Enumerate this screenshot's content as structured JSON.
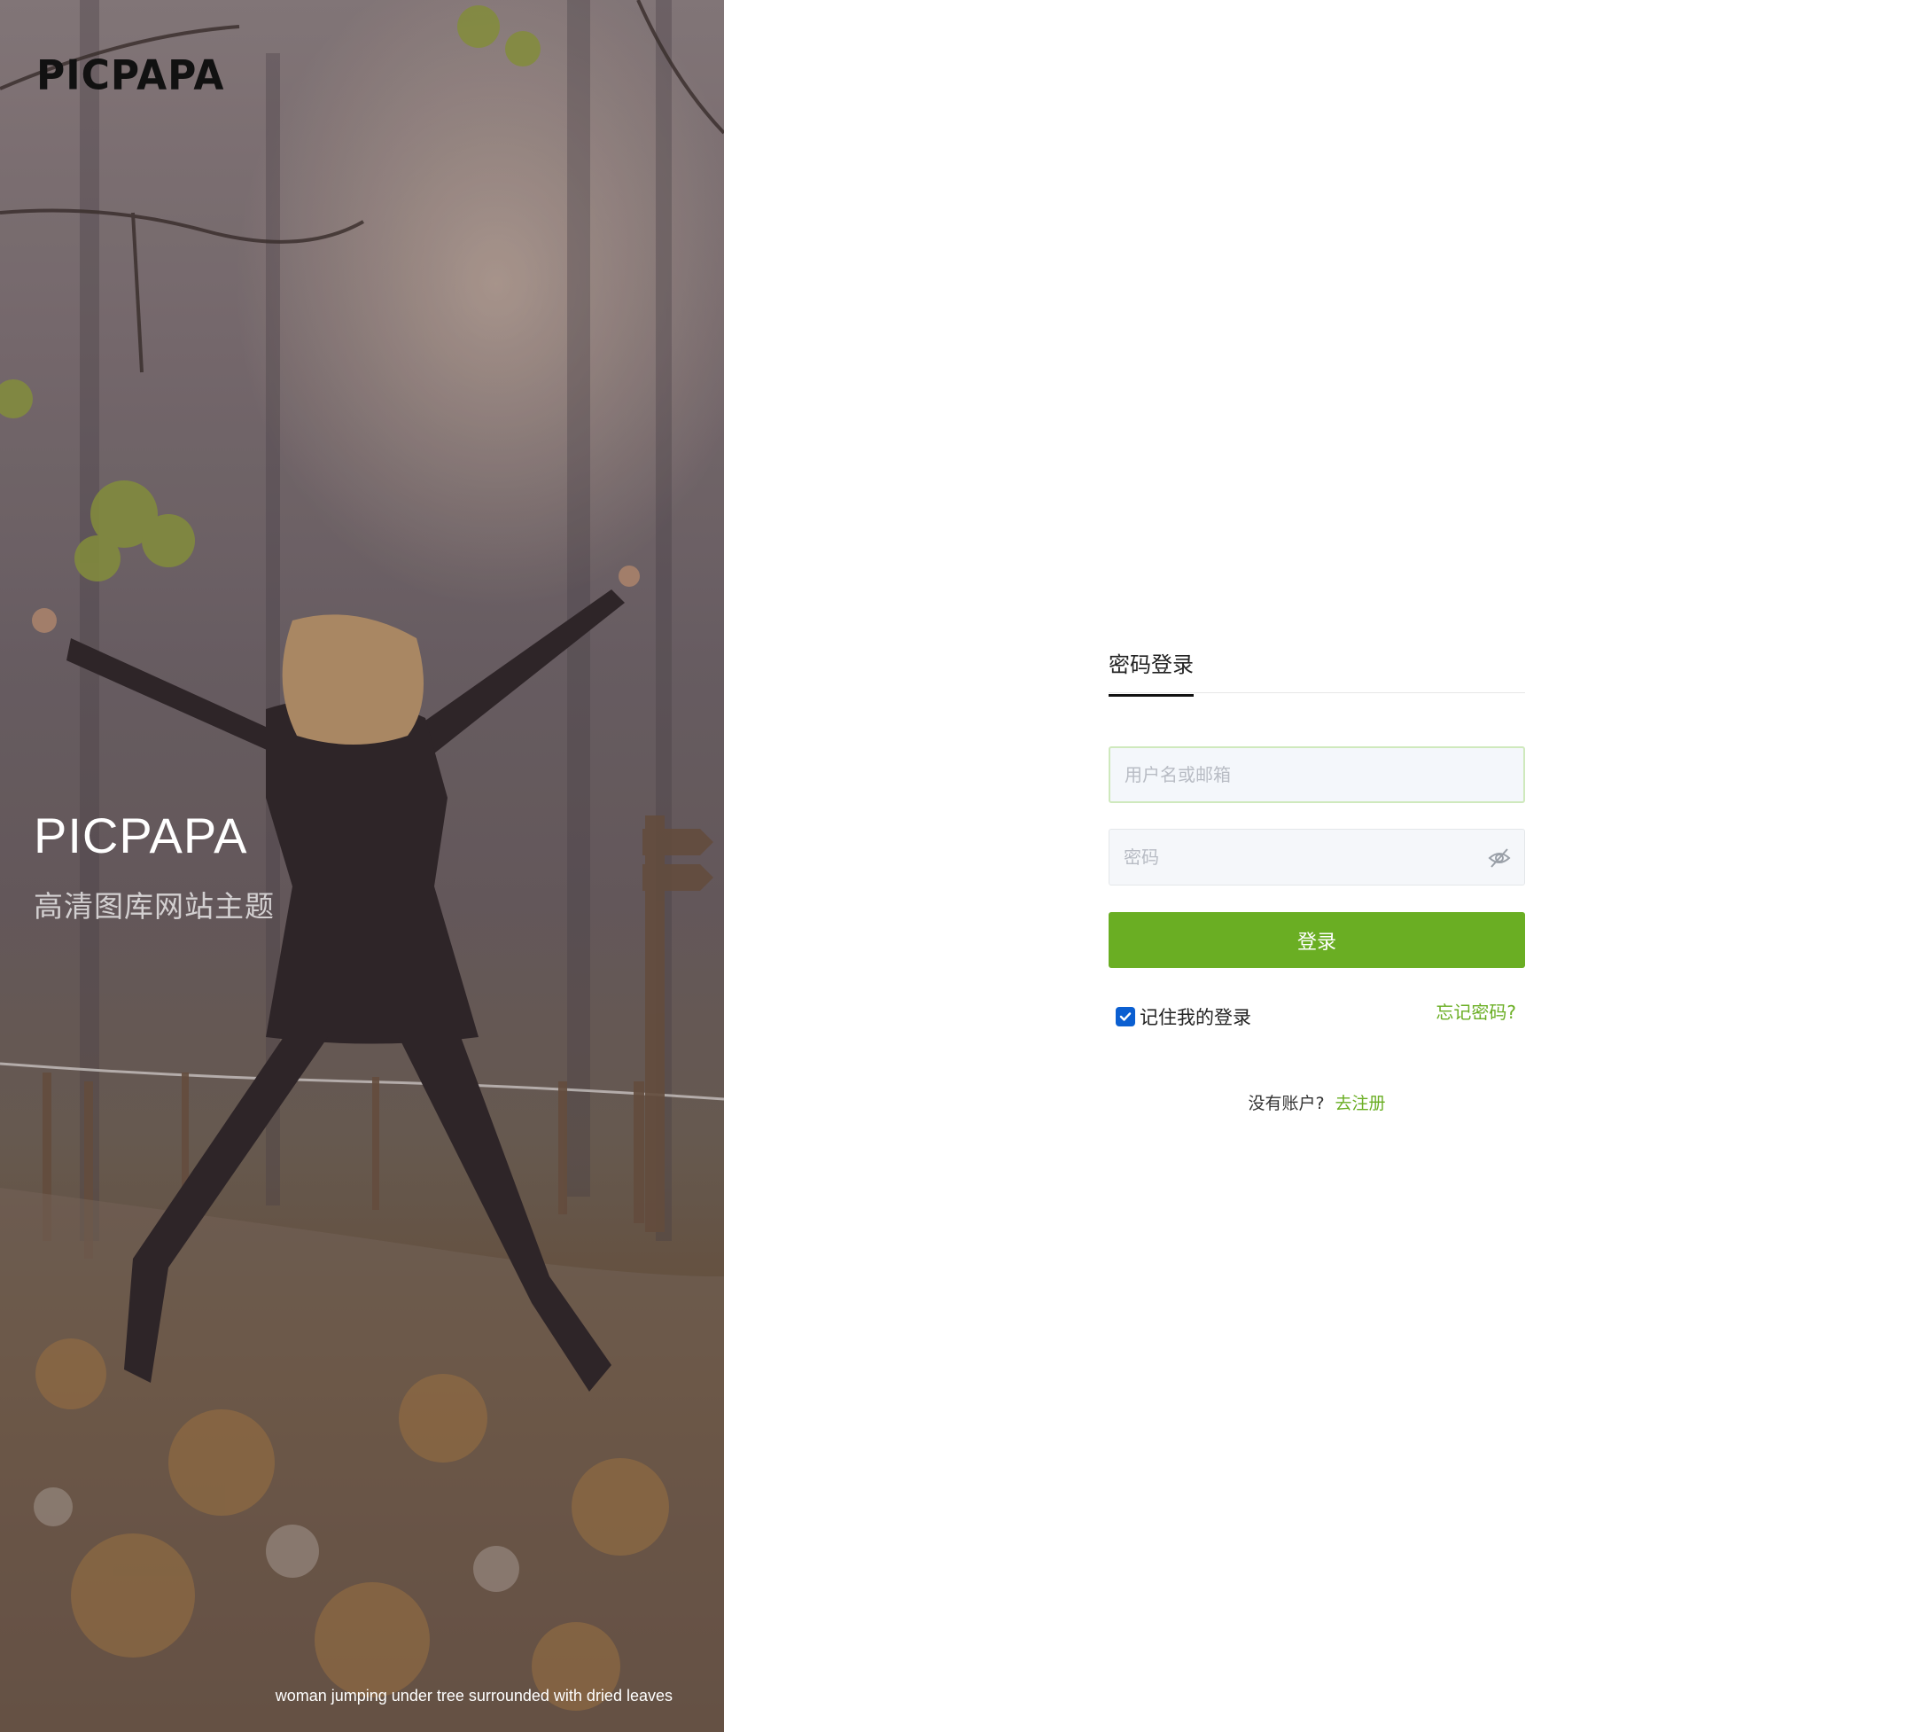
{
  "brand": {
    "logo_text": "PICPAPA",
    "hero_title": "PICPAPA",
    "hero_subtitle": "高清图库网站主题",
    "photo_caption": "woman jumping under tree surrounded with dried leaves"
  },
  "login": {
    "tab_label": "密码登录",
    "username_placeholder": "用户名或邮箱",
    "username_value": "",
    "password_placeholder": "密码",
    "password_value": "",
    "submit_label": "登录",
    "remember_label": "记住我的登录",
    "remember_checked": true,
    "forgot_label": "忘记密码?",
    "no_account_text": "没有账户?",
    "signup_label": "去注册"
  },
  "colors": {
    "accent": "#6aae23",
    "checkbox": "#0b5fd1",
    "tab_underline": "#111111"
  },
  "icons": {
    "password_toggle": "eye-off-icon",
    "remember_check": "checkmark-icon"
  }
}
